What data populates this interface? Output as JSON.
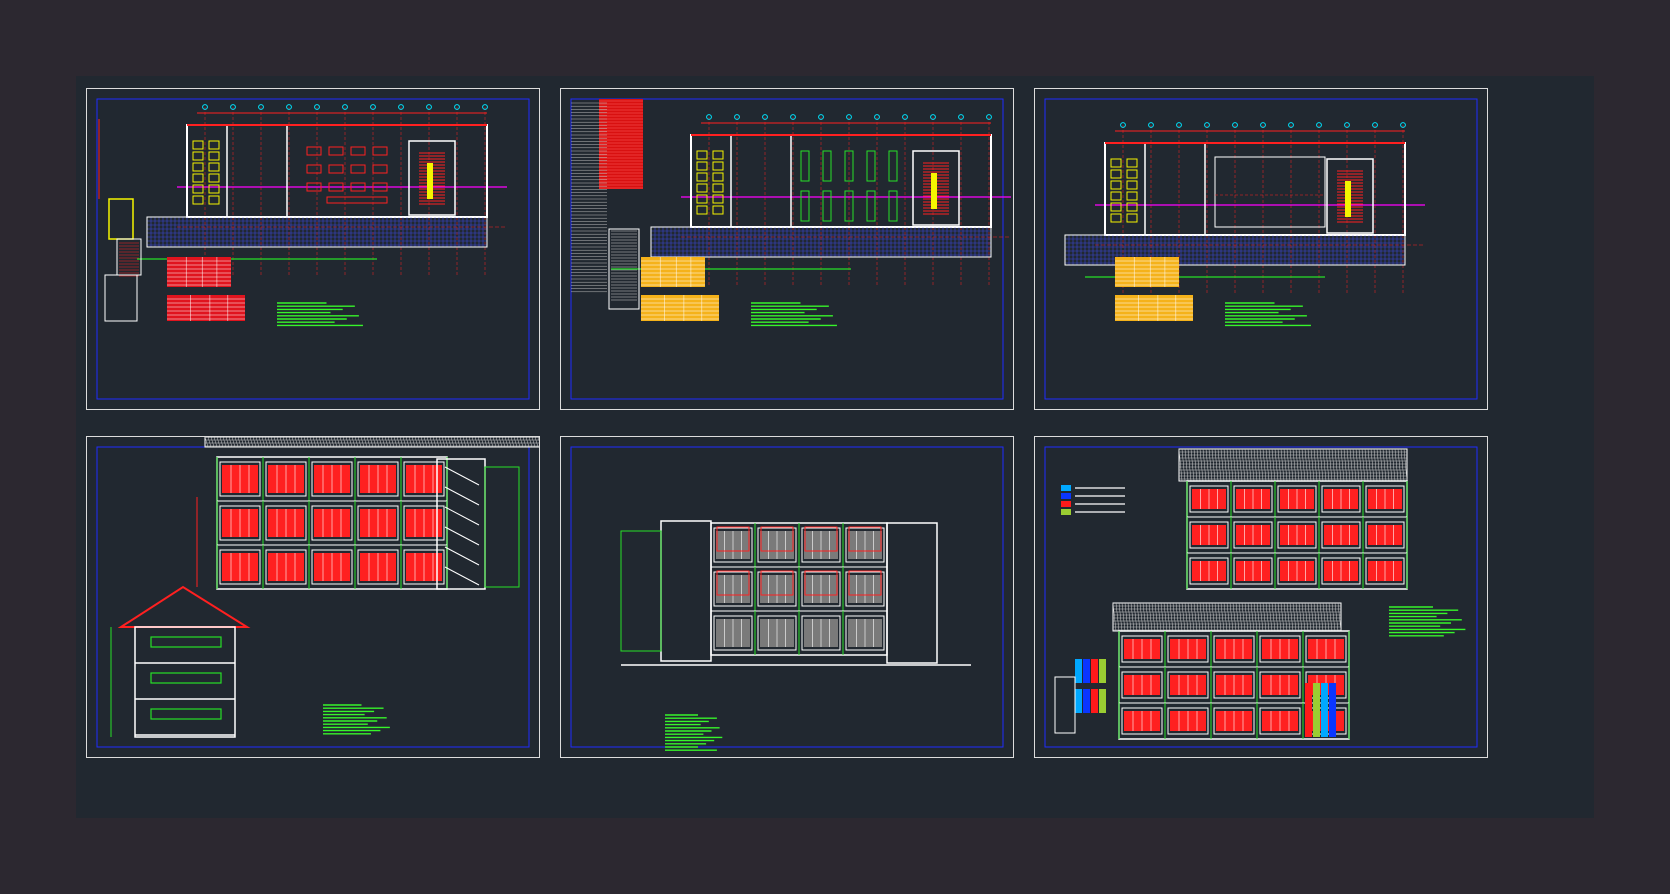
{
  "workspace": {
    "background": "#212830",
    "page_background": "#2c2830"
  },
  "sheets": [
    {
      "id": "sheet-1",
      "kind": "floor-plan",
      "caption": "",
      "table_colors": [
        "#e0141e",
        "#e0141e"
      ]
    },
    {
      "id": "sheet-2",
      "kind": "floor-plan",
      "caption": "",
      "table_colors": [
        "#f5b21a",
        "#f5b21a"
      ]
    },
    {
      "id": "sheet-3",
      "kind": "floor-plan",
      "caption": "",
      "table_colors": [
        "#f5b21a",
        "#f5b21a"
      ]
    },
    {
      "id": "sheet-4",
      "kind": "sections",
      "caption": ""
    },
    {
      "id": "sheet-5",
      "kind": "section-elevation",
      "caption": ""
    },
    {
      "id": "sheet-6",
      "kind": "elevations",
      "caption": "",
      "legend_colors": [
        "#00a8ff",
        "#0a36ff",
        "#ff1a1a",
        "#9acd32"
      ]
    }
  ],
  "colors": {
    "sheet_border": "#dcdcdc",
    "inner_frame": "#1f2cff",
    "wall": "#ffffff",
    "axis_red": "#ff2020",
    "axis_magenta": "#ff00ff",
    "cyan": "#00e5ff",
    "green": "#27e027",
    "yellow": "#f5f500",
    "hatch_blue": "#3b47d6",
    "notes_green": "#37f52a"
  }
}
